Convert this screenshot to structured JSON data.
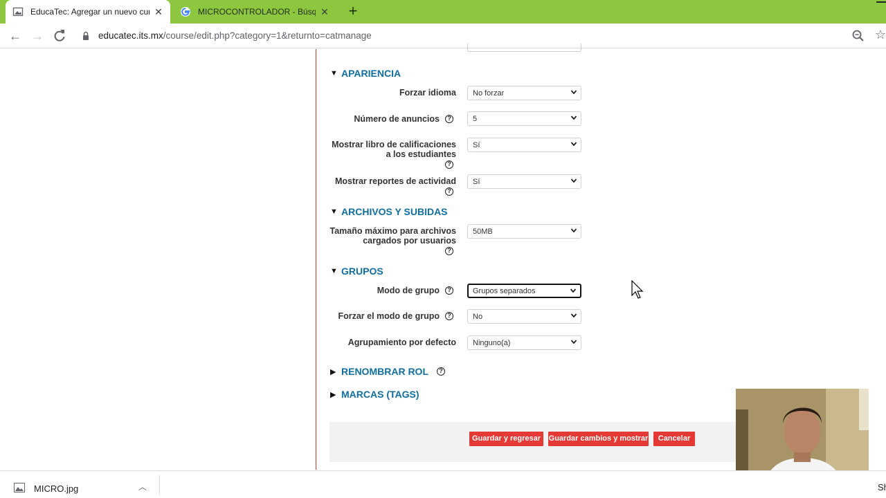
{
  "browser": {
    "tabs": [
      {
        "title": "EducaTec: Agregar un nuevo curso",
        "active": true
      },
      {
        "title": "MICROCONTROLADOR - Búsqueda de Google",
        "active": false
      }
    ],
    "new_tab": "+",
    "close_glyph": "✕",
    "url_host": "educatec.its.mx",
    "url_path": "/course/edit.php?category=1&returnto=catmanage",
    "accent_color": "#8dc63f"
  },
  "sections": {
    "apariencia": {
      "title": "APARIENCIA",
      "forzar_idioma": {
        "label": "Forzar idioma",
        "value": "No forzar"
      },
      "numero_anuncios": {
        "label": "Número de anuncios",
        "value": "5"
      },
      "libro_calificaciones": {
        "label": "Mostrar libro de calificaciones a los estudiantes",
        "value": "Sí"
      },
      "reportes_actividad": {
        "label": "Mostrar reportes de actividad",
        "value": "Sí"
      }
    },
    "archivos": {
      "title": "ARCHIVOS Y SUBIDAS",
      "tamano_maximo": {
        "label": "Tamaño máximo para archivos cargados por usuarios",
        "value": "50MB"
      }
    },
    "grupos": {
      "title": "GRUPOS",
      "modo_grupo": {
        "label": "Modo de grupo",
        "value": "Grupos separados"
      },
      "forzar_modo": {
        "label": "Forzar el modo de grupo",
        "value": "No"
      },
      "agrupamiento": {
        "label": "Agrupamiento por defecto",
        "value": "Ninguno(a)"
      }
    },
    "renombrar_rol": {
      "title": "RENOMBRAR ROL"
    },
    "marcas": {
      "title": "MARCAS (TAGS)"
    }
  },
  "buttons": {
    "save_return": "Guardar y regresar",
    "save_show": "Guardar cambios y mostrar",
    "cancel": "Cancelar",
    "color": "#e53935"
  },
  "help_glyph": "?",
  "download": {
    "filename": "MICRO.jpg",
    "show_all": "Sh"
  }
}
